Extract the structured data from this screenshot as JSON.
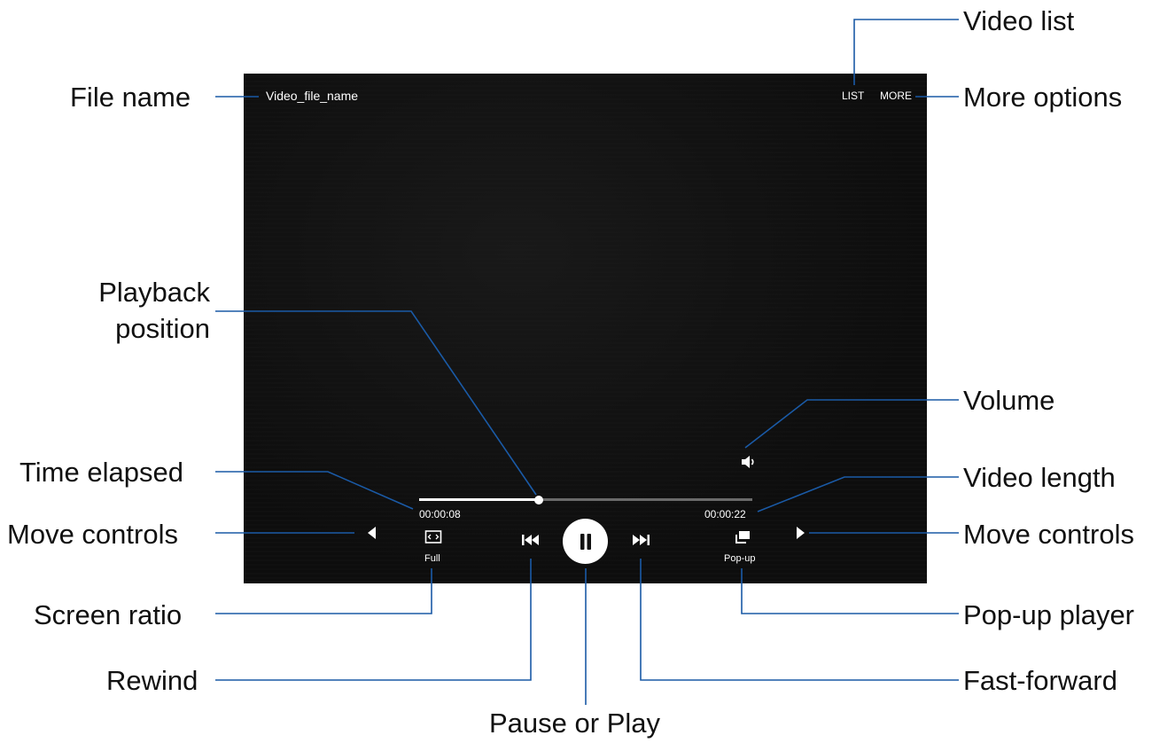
{
  "player": {
    "file_name": "Video_file_name",
    "list_label": "LIST",
    "more_label": "MORE",
    "time_elapsed": "00:00:08",
    "video_length": "00:00:22",
    "playback_progress": 0.36,
    "screen_ratio_label": "Full",
    "popup_label": "Pop-up"
  },
  "callouts": {
    "file_name": "File name",
    "video_list": "Video list",
    "more_options": "More options",
    "playback_position_line1": "Playback",
    "playback_position_line2": "position",
    "volume": "Volume",
    "time_elapsed": "Time elapsed",
    "video_length": "Video length",
    "move_controls_left": "Move controls",
    "move_controls_right": "Move controls",
    "screen_ratio": "Screen ratio",
    "popup_player": "Pop-up player",
    "rewind": "Rewind",
    "fast_forward": "Fast-forward",
    "pause_or_play": "Pause or Play"
  },
  "colors": {
    "leader_line": "#1a5aa6",
    "player_bg": "#0d0d0d",
    "seek_fill": "#ffffff",
    "seek_track": "#6a6a6a"
  },
  "icons": {
    "volume": "volume-icon",
    "screen_ratio": "screen-ratio-icon",
    "rewind": "rewind-icon",
    "pause": "pause-icon",
    "fast_forward": "fast-forward-icon",
    "popup": "popup-player-icon",
    "move_left": "move-controls-left-icon",
    "move_right": "move-controls-right-icon"
  }
}
